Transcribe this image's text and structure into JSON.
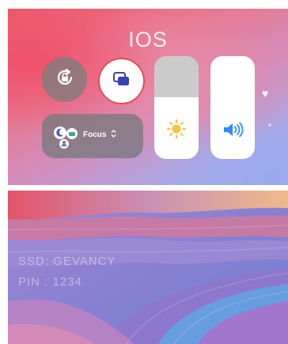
{
  "control_center": {
    "title": "IOS",
    "focus": {
      "label": "Focus",
      "chevron": "⌃⌄"
    },
    "buttons": {
      "rotation_lock": {
        "icon": "rotation-lock-icon"
      },
      "screen_mirroring": {
        "icon": "screen-mirroring-icon",
        "highlight_color": "#e14c52"
      }
    },
    "brightness": {
      "icon": "sun-icon",
      "level": 0.6
    },
    "volume": {
      "icon": "speaker-icon",
      "level": 1.0
    },
    "side_icons": [
      "heart-icon"
    ]
  },
  "wallpaper": {
    "ssd_text": "SSD: GEVANCY",
    "pin_text": "PIN : 1234"
  },
  "colors": {
    "sun": "#f5c242",
    "speaker": "#2e8cff",
    "mirror_icon": "#3a3fb4"
  }
}
